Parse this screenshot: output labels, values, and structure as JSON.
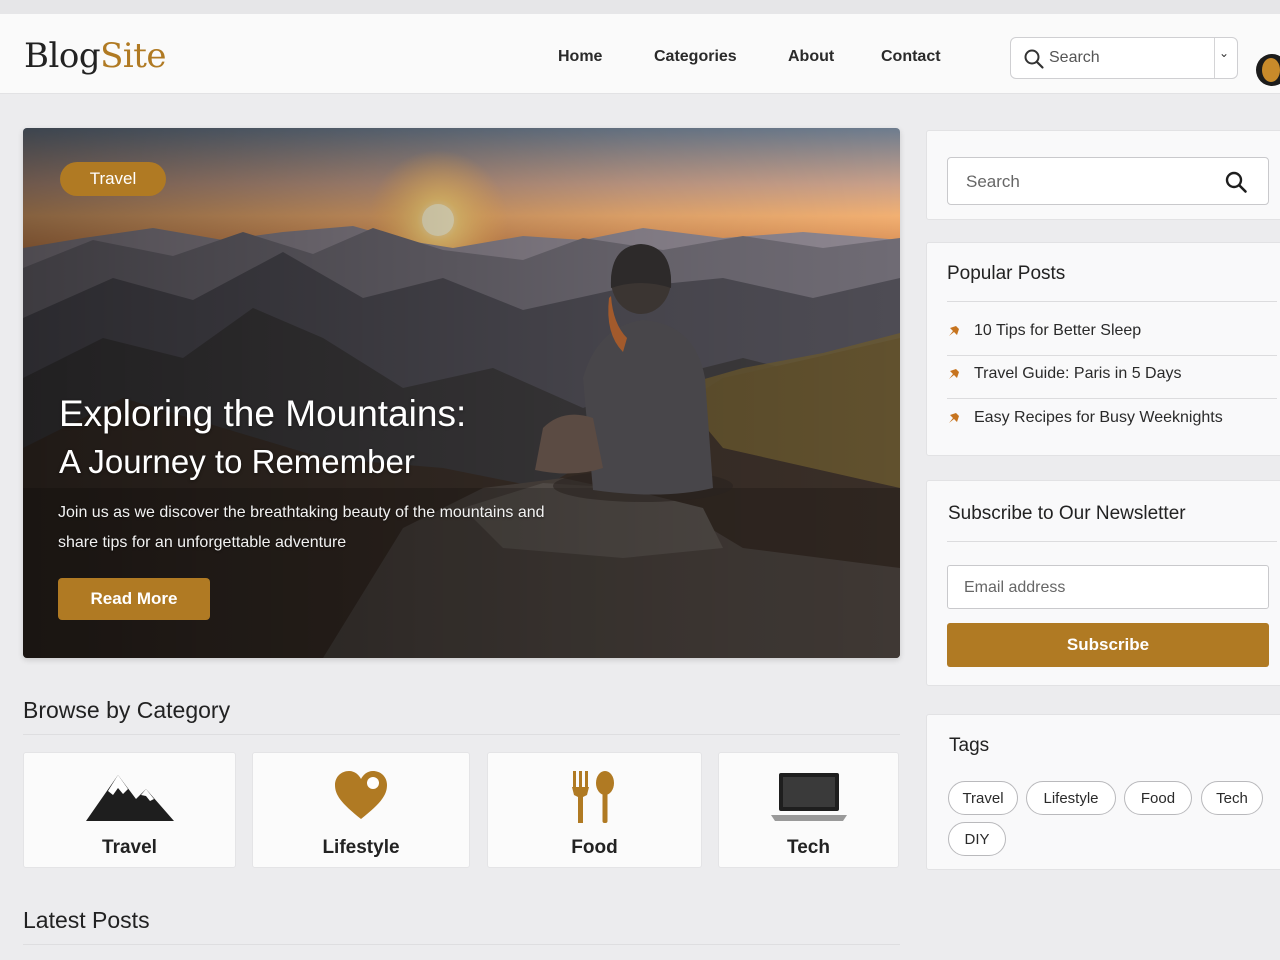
{
  "header": {
    "logo_part1": "Blog",
    "logo_part2": "Site",
    "nav": [
      "Home",
      "Categories",
      "About",
      "Contact"
    ],
    "search_placeholder": "Search"
  },
  "hero": {
    "badge": "Travel",
    "title_line1": "Exploring the Mountains:",
    "title_line2": "A Journey to Remember",
    "desc_line1": "Join us as we discover the breathtaking beauty of the mountains and",
    "desc_line2": "share tips for an unforgettable adventure",
    "button": "Read More"
  },
  "browse": {
    "title": "Browse by Category",
    "categories": [
      {
        "label": "Travel",
        "icon": "mountain-icon"
      },
      {
        "label": "Lifestyle",
        "icon": "heart-icon"
      },
      {
        "label": "Food",
        "icon": "fork-spoon-icon"
      },
      {
        "label": "Tech",
        "icon": "laptop-icon"
      }
    ]
  },
  "latest": {
    "title": "Latest Posts"
  },
  "sidebar": {
    "search_placeholder": "Search",
    "popular": {
      "title": "Popular Posts",
      "items": [
        "10 Tips for Better Sleep",
        "Travel Guide: Paris in 5 Days",
        "Easy Recipes for Busy Weeknights"
      ]
    },
    "newsletter": {
      "title": "Subscribe to Our Newsletter",
      "email_placeholder": "Email address",
      "button": "Subscribe"
    },
    "tags": {
      "title": "Tags",
      "items": [
        "Travel",
        "Lifestyle",
        "Food",
        "Tech",
        "DIY"
      ]
    }
  },
  "colors": {
    "accent": "#b07a23",
    "background": "#ececee",
    "panel": "#f9f9fa"
  }
}
